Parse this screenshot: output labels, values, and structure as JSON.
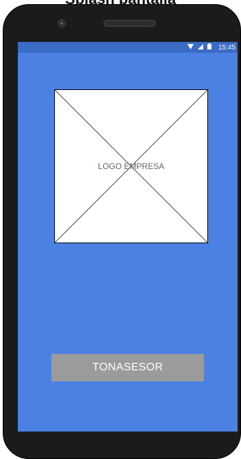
{
  "header_caption": "Splash pantalla",
  "status_bar": {
    "icons": [
      "wifi-icon",
      "cell-signal-icon",
      "battery-icon"
    ],
    "time": "15:45"
  },
  "logo": {
    "label": "LOGO EMPRESA"
  },
  "button": {
    "label": "TONASESOR"
  },
  "colors": {
    "screen_background": "#4a81e2",
    "status_bar": "#3a6bc5",
    "button": "#9b9b9b",
    "phone_body": "#1b1b1b"
  }
}
